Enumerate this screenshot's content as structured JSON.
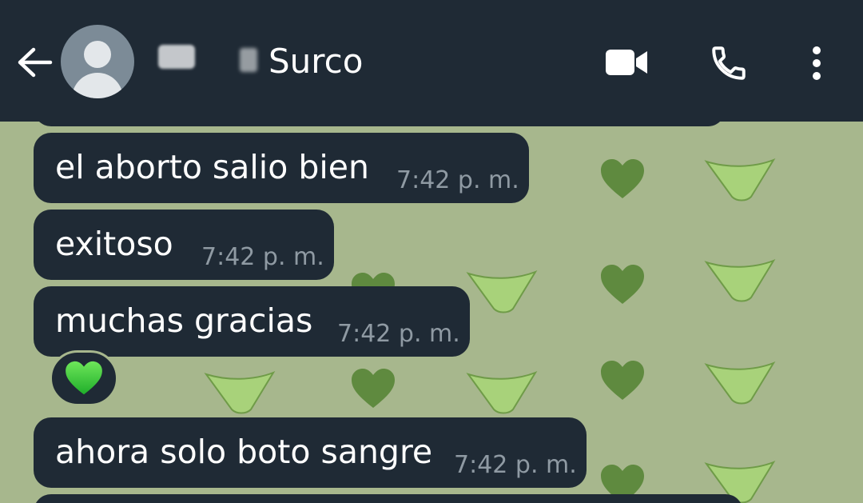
{
  "header": {
    "contact_name": "Surco",
    "icons": [
      "back-arrow-icon",
      "avatar-icon",
      "video-camera-icon",
      "phone-icon",
      "more-vertical-icon"
    ]
  },
  "messages": [
    {
      "text": "el aborto salio bien",
      "time": "7:42 p. m."
    },
    {
      "text": "exitoso",
      "time": "7:42 p. m."
    },
    {
      "text": "muchas gracias",
      "time": "7:42 p. m.",
      "reaction": "💚"
    },
    {
      "text": "ahora solo boto sangre",
      "time": "7:42 p. m."
    }
  ],
  "colors": {
    "header_bg": "#1f2a35",
    "bubble_bg": "#1f2a35",
    "wallpaper": "#a7b78d",
    "heart_green": "#5d8a3d",
    "hanky_green": "#a8d27a"
  }
}
